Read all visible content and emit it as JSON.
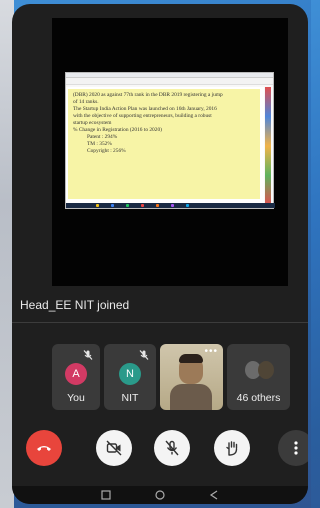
{
  "notification": {
    "joined_text": "Head_EE NIT joined"
  },
  "slide": {
    "lines": [
      "(DBR) 2020 as against 77th rank in the DBR 2019 registering a jump",
      "of 14 ranks.",
      "The Startup India Action Plan was launched on 16th January, 2016",
      "with the objective of supporting entrepreneurs, building a robust",
      "startup ecosystem",
      "% Change in Registration (2016 to 2020)",
      "Patent      :  294%",
      "TM          :  352%",
      "Copyright  :  256%"
    ]
  },
  "participants": [
    {
      "initial": "A",
      "label": "You",
      "color": "#d23a64",
      "muted": true
    },
    {
      "initial": "N",
      "label": "NIT",
      "color": "#2a9a8a",
      "muted": true
    }
  ],
  "others": {
    "label": "46 others"
  },
  "colors": {
    "end_call": "#e8453c",
    "tile_bg": "#3a3a3a"
  }
}
